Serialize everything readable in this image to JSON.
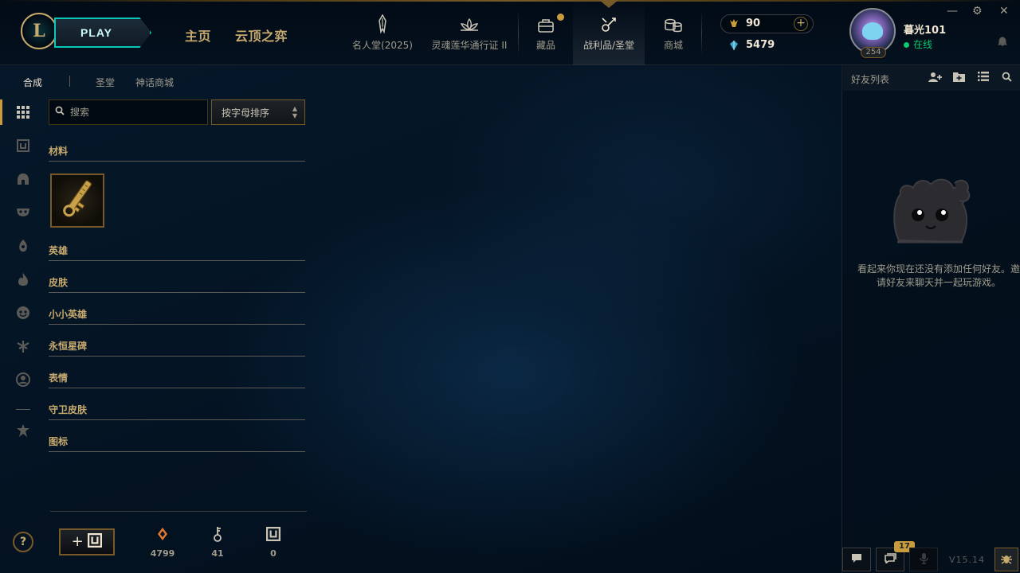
{
  "header": {
    "logo_letter": "L",
    "play_label": "PLAY",
    "nav_main": [
      "主页",
      "云顶之弈"
    ],
    "nav_icons": [
      {
        "label": "名人堂(2025)",
        "icon": "hall-of-legends-icon"
      },
      {
        "label": "灵魂莲华通行证 II",
        "icon": "lotus-pass-icon"
      },
      {
        "label": "藏品",
        "icon": "collection-icon",
        "has_notification": true
      },
      {
        "label": "战利品/圣堂",
        "icon": "loot-icon",
        "active": true
      },
      {
        "label": "商城",
        "icon": "store-icon"
      }
    ],
    "rp_amount": "90",
    "be_amount": "5479",
    "add_rp_label": "+",
    "username": "暮光101",
    "status": "在线",
    "level": "254",
    "window_controls": [
      "—",
      "⚙",
      "✕"
    ]
  },
  "subnav": {
    "tabs": [
      "合成",
      "圣堂",
      "神话商城"
    ],
    "active_tab": "合成"
  },
  "rail": {
    "icons": [
      "grid-icon",
      "chest-icon",
      "champion-helmet-icon",
      "skin-mask-icon",
      "ward-icon",
      "emote-flame-icon",
      "little-legend-icon",
      "eternals-icon",
      "profile-icon",
      "icon-ribbon-icon"
    ]
  },
  "toolbar": {
    "search_placeholder": "搜索",
    "sort_label": "按字母排序"
  },
  "categories": [
    "材料",
    "英雄",
    "皮肤",
    "小小英雄",
    "永恒星碑",
    "表情",
    "守卫皮肤",
    "图标"
  ],
  "materials": [
    {
      "name": "hextech-key",
      "icon": "key-fragment-icon"
    }
  ],
  "footer": {
    "help_label": "?",
    "craft_label": "+",
    "resources": [
      {
        "icon": "orange-essence-icon",
        "value": "4799"
      },
      {
        "icon": "key-icon",
        "value": "41"
      },
      {
        "icon": "chest-icon",
        "value": "0"
      }
    ]
  },
  "social": {
    "title": "好友列表",
    "empty_message": "看起来你现在还没有添加任何好友。邀请好友来聊天并一起玩游戏。",
    "chat_count": "17",
    "version": "V15.14"
  },
  "colors": {
    "gold": "#c8aa6e",
    "gold_dark": "#785a28",
    "teal": "#0ac8b9",
    "online": "#0acb6e",
    "background": "#010a13"
  }
}
